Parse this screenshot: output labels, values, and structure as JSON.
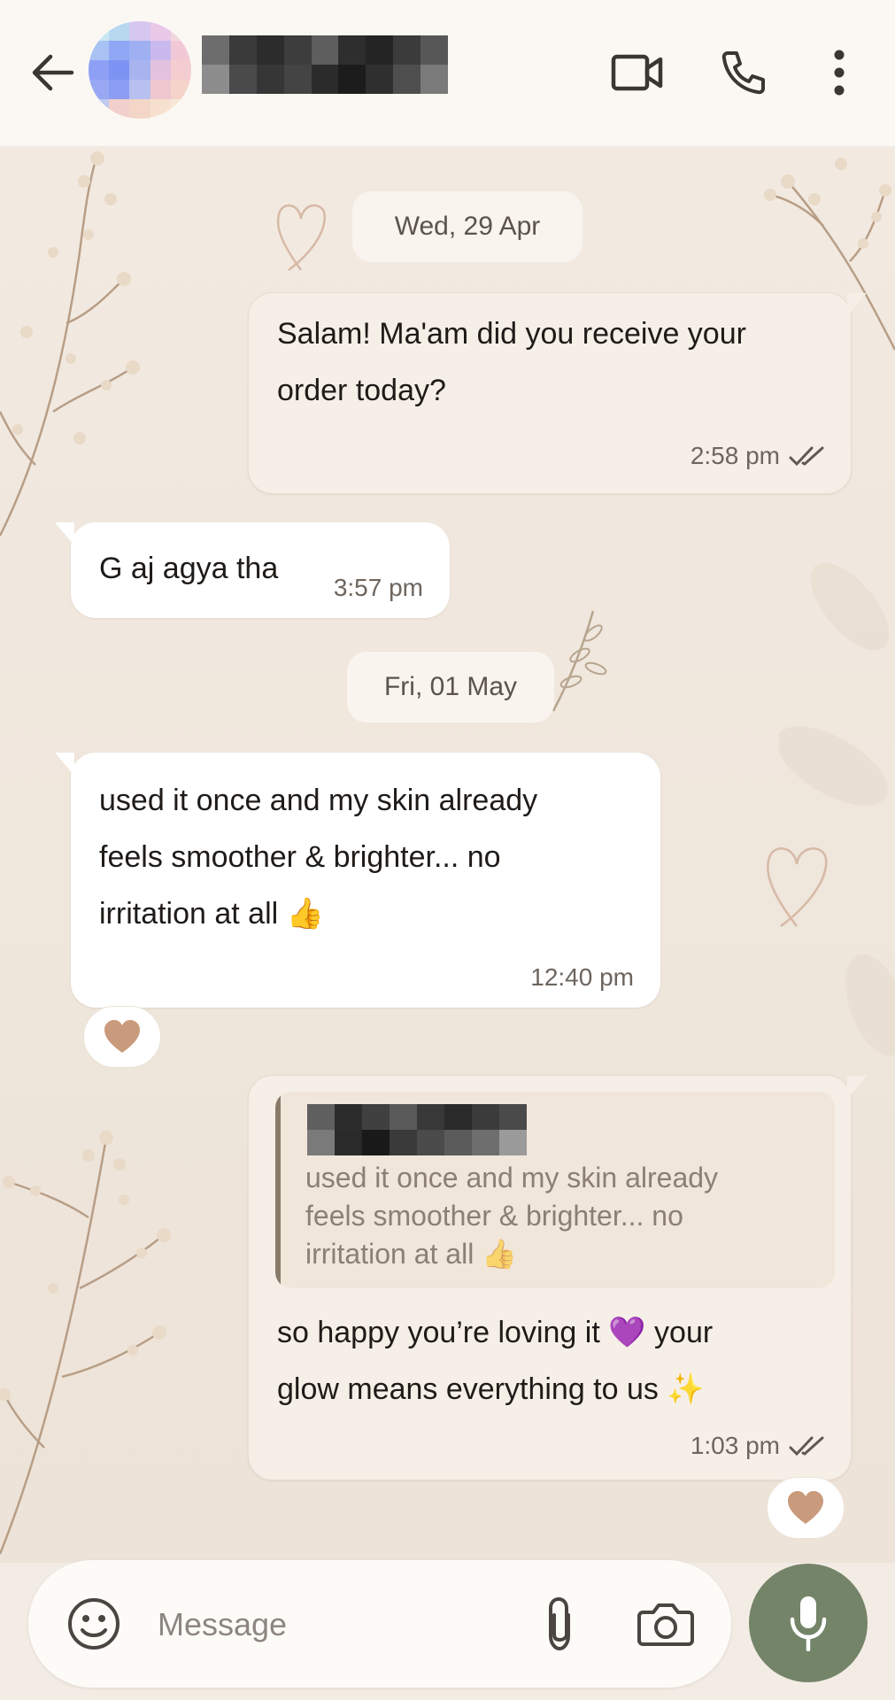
{
  "header": {
    "back_icon": "arrow-left-icon",
    "video_icon": "video-camera-icon",
    "call_icon": "phone-icon",
    "menu_icon": "more-vertical-icon"
  },
  "messages": [
    {
      "type": "date",
      "label": "Wed, 29 Apr"
    },
    {
      "type": "out",
      "text_line1": "Salam! Ma'am did you receive your",
      "text_line2": "order today?",
      "time": "2:58 pm",
      "status": "read"
    },
    {
      "type": "in",
      "text": "G aj agya tha",
      "time": "3:57 pm"
    },
    {
      "type": "date",
      "label": "Fri, 01 May"
    },
    {
      "type": "in",
      "text_line1": "used it once and my skin already",
      "text_line2": "feels smoother & brighter... no",
      "text_line3": "irritation at all",
      "emoji": "👍",
      "time": "12:40 pm",
      "reaction": "🤎"
    },
    {
      "type": "out",
      "quote": {
        "line1": "used it once and my skin already",
        "line2": "feels smoother & brighter... no",
        "line3": "irritation at all",
        "emoji": "👍"
      },
      "text_line1a": "so happy you’re loving it",
      "emoji1": "💜",
      "text_line1b": "your",
      "text_line2": "glow means everything to us",
      "emoji2": "✨",
      "time": "1:03 pm",
      "status": "read",
      "reaction": "🤎"
    }
  ],
  "composer": {
    "placeholder": "Message",
    "emoji_icon": "smiley-icon",
    "attach_icon": "paperclip-icon",
    "camera_icon": "camera-icon",
    "mic_icon": "microphone-icon"
  },
  "colors": {
    "header_bg": "#fbf8f4",
    "wallpaper": "#f2eae1",
    "out_bubble": "#f6efe7",
    "in_bubble": "#ffffff",
    "mic_button": "#748468"
  }
}
